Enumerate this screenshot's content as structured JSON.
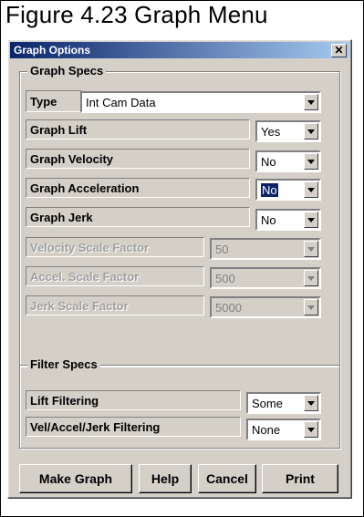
{
  "figure_title": "Figure 4.23  Graph Menu",
  "dialog": {
    "title": "Graph Options",
    "close_glyph": "✕"
  },
  "graph_specs": {
    "legend": "Graph Specs",
    "type_label": "Type",
    "type_value": "Int Cam Data",
    "rows": [
      {
        "label": "Graph Lift",
        "value": "Yes"
      },
      {
        "label": "Graph Velocity",
        "value": "No"
      },
      {
        "label": "Graph Acceleration",
        "value": "No"
      },
      {
        "label": "Graph Jerk",
        "value": "No"
      },
      {
        "label": "Velocity Scale Factor",
        "value": "50"
      },
      {
        "label": "Accel. Scale Factor",
        "value": "500"
      },
      {
        "label": "Jerk Scale Factor",
        "value": "5000"
      }
    ]
  },
  "filter_specs": {
    "legend": "Filter Specs",
    "rows": [
      {
        "label": "Lift Filtering",
        "value": "Some"
      },
      {
        "label": "Vel/Accel/Jerk Filtering",
        "value": "None"
      }
    ]
  },
  "buttons": {
    "make_graph": "Make Graph",
    "help": "Help",
    "cancel": "Cancel",
    "print": "Print"
  }
}
